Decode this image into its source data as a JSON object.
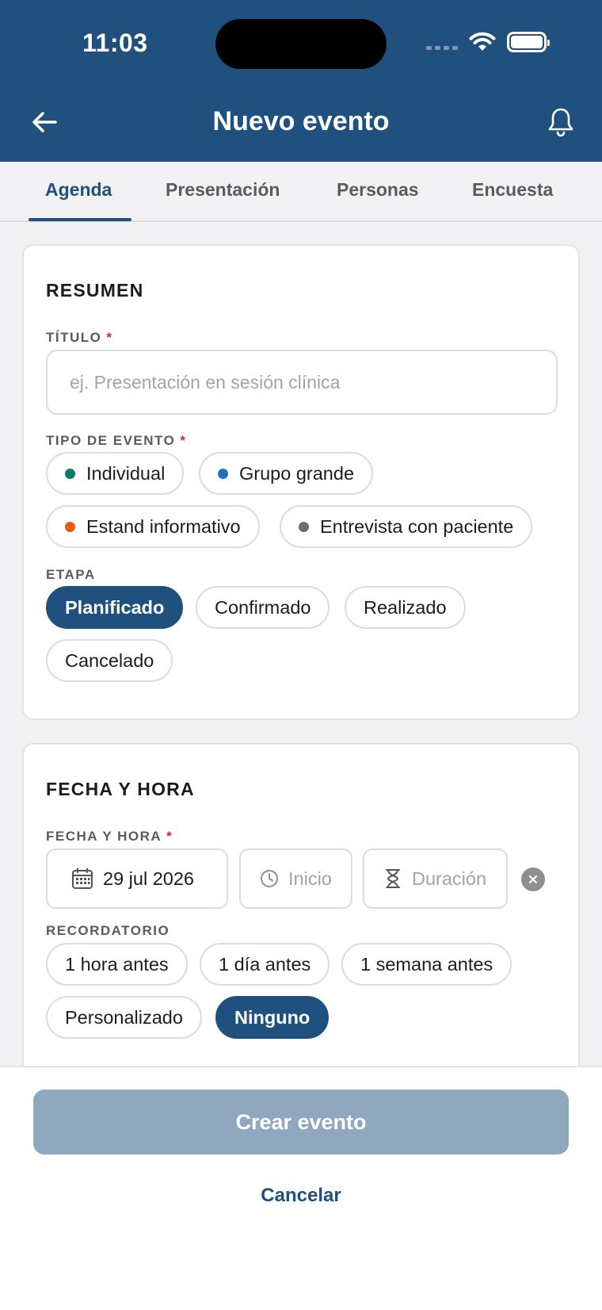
{
  "status_bar": {
    "time": "11:03"
  },
  "header": {
    "title": "Nuevo evento"
  },
  "tabs": [
    {
      "label": "Agenda",
      "active": true
    },
    {
      "label": "Presentación",
      "active": false
    },
    {
      "label": "Personas",
      "active": false
    },
    {
      "label": "Encuesta",
      "active": false
    }
  ],
  "summary": {
    "title": "RESUMEN",
    "title_field": {
      "label": "TÍTULO",
      "required_mark": "*",
      "value": "",
      "placeholder": "ej. Presentación en sesión clínica"
    },
    "event_type": {
      "label": "TIPO DE EVENTO",
      "required_mark": "*",
      "options": [
        {
          "label": "Individual",
          "color": "#0f7a66"
        },
        {
          "label": "Grupo grande",
          "color": "#1f6fc9"
        },
        {
          "label": "Estand informativo",
          "color": "#e06010"
        },
        {
          "label": "Entrevista con paciente",
          "color": "#6b6b70"
        }
      ]
    },
    "stage": {
      "label": "ETAPA",
      "selected": "Planificado",
      "options": [
        "Planificado",
        "Confirmado",
        "Realizado",
        "Cancelado"
      ]
    }
  },
  "datetime": {
    "title": "FECHA Y HORA",
    "field_label": "FECHA Y HORA",
    "required_mark": "*",
    "date_value": "29 jul 2026",
    "start_placeholder": "Inicio",
    "duration_placeholder": "Duración",
    "reminder": {
      "label": "RECORDATORIO",
      "selected": "Ninguno",
      "options": [
        "1 hora antes",
        "1 día antes",
        "1 semana antes",
        "Personalizado",
        "Ninguno"
      ]
    }
  },
  "footer": {
    "create_label": "Crear evento",
    "cancel_label": "Cancelar"
  },
  "colors": {
    "brand": "#20507e",
    "disabled_button": "#90a8bf",
    "required": "#c62828"
  }
}
